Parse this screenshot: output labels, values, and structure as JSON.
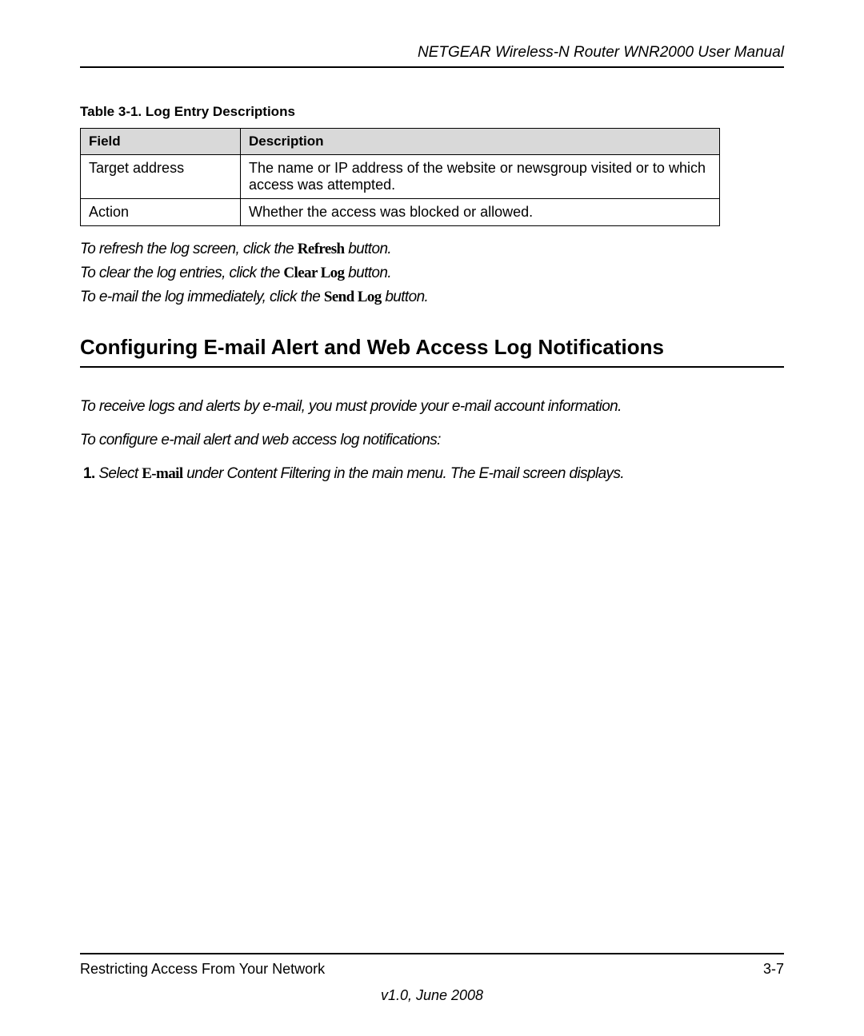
{
  "header": "NETGEAR Wireless-N Router WNR2000 User Manual",
  "table": {
    "caption": "Table 3-1.  Log Entry Descriptions",
    "headers": [
      "Field",
      "Description"
    ],
    "rows": [
      [
        "Target address",
        "The name or IP address of the website or newsgroup visited or to which access was attempted."
      ],
      [
        "Action",
        "Whether the access was blocked or allowed."
      ]
    ]
  },
  "actions": [
    {
      "prefix": "To refresh the log screen, click the ",
      "button": "Refresh",
      "suffix": " button."
    },
    {
      "prefix": "To clear the log entries, click the ",
      "button": "Clear Log",
      "suffix": " button."
    },
    {
      "prefix": "To e-mail the log immediately, click the ",
      "button": "Send Log",
      "suffix": " button."
    }
  ],
  "section_heading": "Configuring E-mail Alert and Web Access Log Notifications",
  "paragraphs": [
    "To receive logs and alerts by e-mail, you must provide your e-mail account information.",
    "To configure e-mail alert and web access log notifications:"
  ],
  "step": {
    "num": "1.",
    "pre": "Select ",
    "bold": "E-mail",
    "post": " under Content Filtering in the main menu. The E-mail screen displays."
  },
  "footer": {
    "left": "Restricting Access From Your Network",
    "right": "3-7",
    "center": "v1.0, June 2008"
  }
}
